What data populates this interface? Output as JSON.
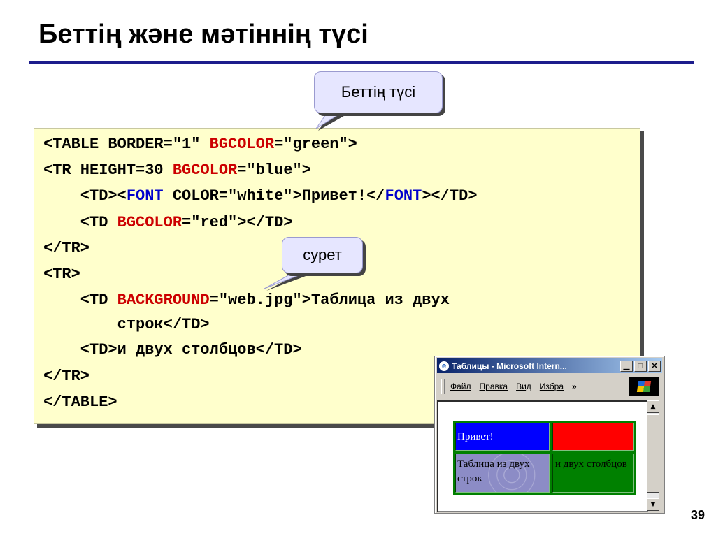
{
  "slide": {
    "title": "Беттің және мәтіннің түсі",
    "page_number": "39"
  },
  "callouts": {
    "page_color": "Беттің түсі",
    "image": "сурет"
  },
  "code": {
    "l1_a": "<TABLE BORDER=\"1\" ",
    "l1_kw": "BGCOLOR",
    "l1_b": "=\"green\">",
    "l2_a": "<TR HEIGHT=30 ",
    "l2_kw": "BGCOLOR",
    "l2_b": "=\"blue\">",
    "l3_a": "    <TD><",
    "l3_fn": "FONT",
    "l3_b": " COLOR=\"white\">Привет!</",
    "l3_fn2": "FONT",
    "l3_c": "></TD>",
    "l4_a": "    <TD ",
    "l4_kw": "BGCOLOR",
    "l4_b": "=\"red\"></TD>",
    "l5": "</TR>",
    "l6": "<TR>",
    "l7_a": "    <TD ",
    "l7_kw": "BACKGROUND",
    "l7_b": "=\"web.jpg\">Таблица из двух",
    "l8": "        строк</TD>",
    "l9": "    <TD>и двух столбцов</TD>",
    "l10": "</TR>",
    "l11": "</TABLE>"
  },
  "browser": {
    "title": "Таблицы - Microsoft Intern...",
    "menu": [
      "Файл",
      "Правка",
      "Вид",
      "Избра"
    ],
    "more": "»",
    "cells": {
      "c1": "Привет!",
      "c3": "Таблица из двух строк",
      "c4": "и двух столбцов"
    }
  },
  "colors": {
    "title_rule": "#1c1c8c",
    "code_bg": "#ffffcc",
    "keyword": "#cc0000",
    "font_tag": "#0000cc",
    "callout_bg": "#e6e6ff"
  }
}
